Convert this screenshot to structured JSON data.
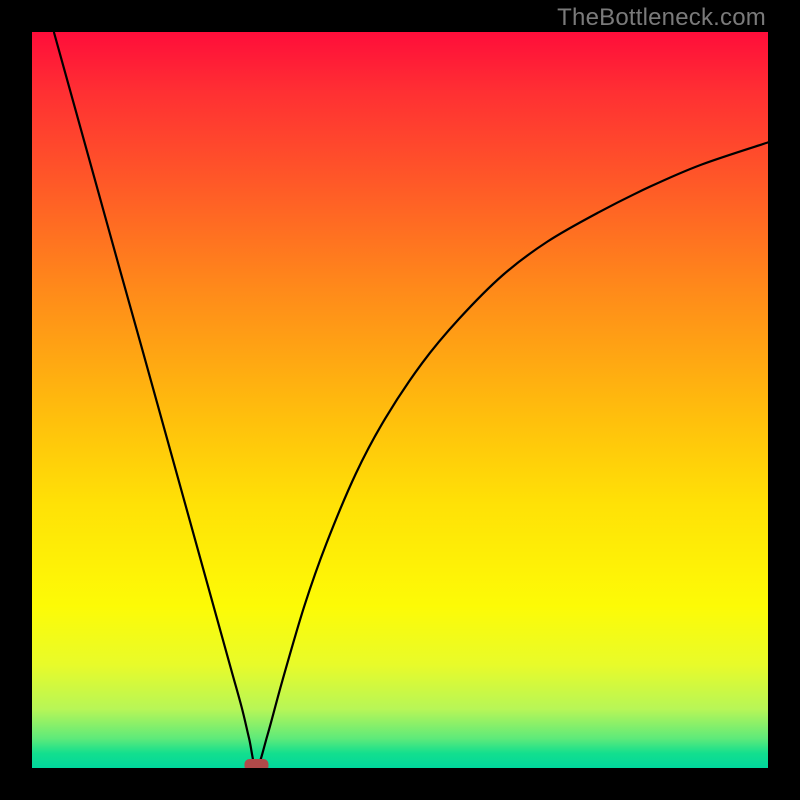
{
  "watermark": "TheBottleneck.com",
  "chart_data": {
    "type": "line",
    "title": "",
    "xlabel": "",
    "ylabel": "",
    "xlim": [
      0,
      100
    ],
    "ylim": [
      0,
      100
    ],
    "series": [
      {
        "name": "bottleneck-curve",
        "x": [
          3,
          6,
          9,
          12,
          15,
          18,
          21,
          24,
          27,
          28.5,
          29.5,
          30.5,
          32,
          34,
          37,
          40,
          44,
          48,
          53,
          58,
          64,
          70,
          77,
          84,
          91,
          100
        ],
        "values": [
          99.9,
          89.1,
          78.3,
          67.5,
          56.8,
          46.0,
          35.2,
          24.4,
          13.6,
          8.2,
          4.0,
          0.0,
          4.5,
          11.8,
          22.0,
          30.5,
          40.0,
          47.5,
          55.0,
          61.0,
          67.0,
          71.5,
          75.5,
          79.0,
          82.0,
          85.0
        ]
      }
    ],
    "marker": {
      "x": 30.5,
      "y": 0,
      "color": "#b04a4a",
      "shape": "rounded-rect"
    }
  }
}
